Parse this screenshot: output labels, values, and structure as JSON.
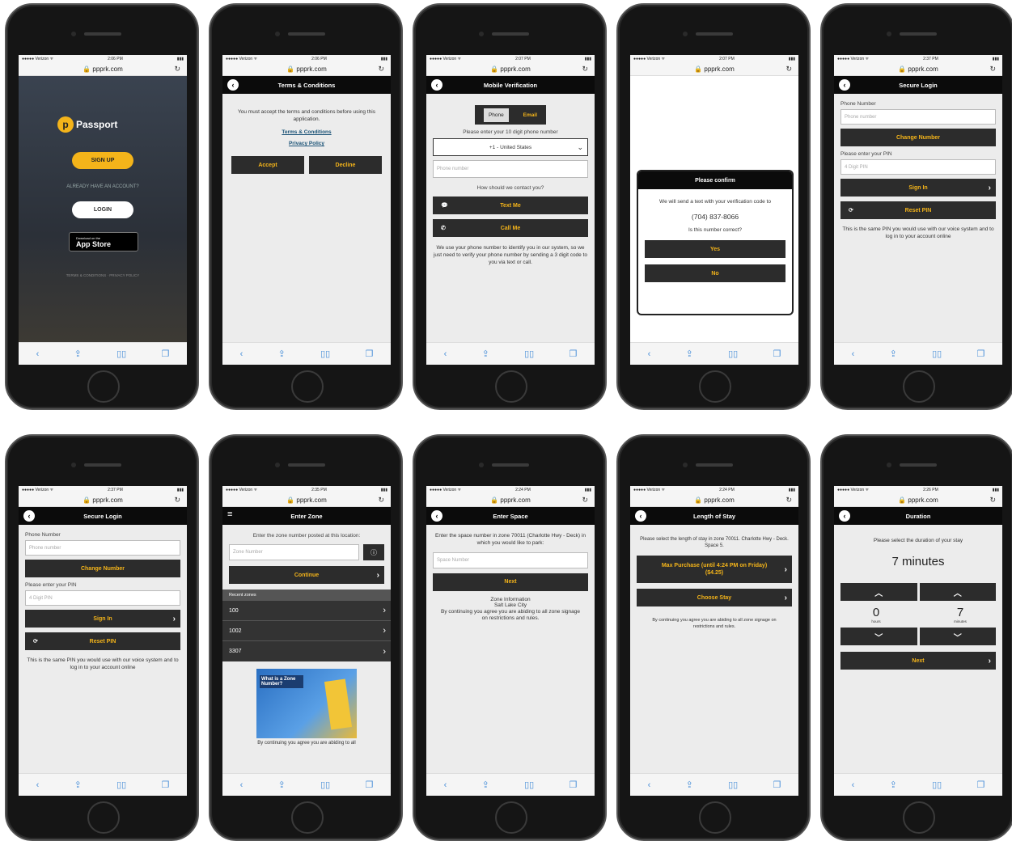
{
  "status": {
    "carrier": "●●●●● Verizon ᯤ",
    "battery": "▮▮▮"
  },
  "phones": [
    {
      "time": "2:06 PM",
      "url": "ppprk.com"
    },
    {
      "time": "2:06 PM",
      "url": "ppprk.com"
    },
    {
      "time": "2:07 PM",
      "url": "ppprk.com"
    },
    {
      "time": "2:07 PM",
      "url": "ppprk.com"
    },
    {
      "time": "2:37 PM",
      "url": "ppprk.com"
    },
    {
      "time": "2:37 PM",
      "url": "ppprk.com"
    },
    {
      "time": "2:35 PM",
      "url": "ppprk.com"
    },
    {
      "time": "2:24 PM",
      "url": "ppprk.com"
    },
    {
      "time": "2:24 PM",
      "url": "ppprk.com"
    },
    {
      "time": "2:26 PM",
      "url": "ppprk.com"
    }
  ],
  "splash": {
    "brand": "Passport",
    "signup": "SIGN UP",
    "already": "ALREADY HAVE AN ACCOUNT?",
    "login": "LOGIN",
    "store_small": "Download on the",
    "store": "App Store",
    "footer": "TERMS & CONDITIONS · PRIVACY POLICY"
  },
  "terms": {
    "title": "Terms & Conditions",
    "text": "You must accept the terms and conditions before using this application.",
    "link1": "Terms & Conditions",
    "link2": "Privacy Policy",
    "accept": "Accept",
    "decline": "Decline"
  },
  "mobile": {
    "title": "Mobile Verification",
    "tab_phone": "Phone",
    "tab_email": "Email",
    "prompt": "Please enter your 10 digit phone number",
    "country": "+1 - United States",
    "placeholder": "Phone number",
    "contact": "How should we contact you?",
    "text_me": "Text Me",
    "call_me": "Call Me",
    "info": "We use your phone number to identify you in our system, so we just need to verify your phone number by sending a 3 digit code to you via text or call."
  },
  "confirm": {
    "title": "Please confirm",
    "text": "We will send a text with your verification code to",
    "number": "(704) 837-8066",
    "question": "Is this number correct?",
    "yes": "Yes",
    "no": "No"
  },
  "login": {
    "title": "Secure Login",
    "phone_label": "Phone Number",
    "phone_placeholder": "Phone number",
    "change": "Change Number",
    "pin_label": "Please enter your PIN",
    "pin_placeholder": "4 Digit PIN",
    "signin": "Sign In",
    "reset": "Reset PIN",
    "info": "This is the same PIN you would use with our voice system and to log in to your account online"
  },
  "zone": {
    "title": "Enter Zone",
    "prompt": "Enter the zone number posted at this location:",
    "placeholder": "Zone Number",
    "continue": "Continue",
    "recent": "Recent zones",
    "zones": [
      "100",
      "1002",
      "3307"
    ],
    "promo_title": "What is a Zone Number?",
    "footer": "By continuing you agree you are abiding to all"
  },
  "space": {
    "title": "Enter Space",
    "prompt": "Enter the space number in zone 70011 (Charlotte Hwy - Deck) in which you would like to park:",
    "placeholder": "Space Number",
    "next": "Next",
    "info_title": "Zone Information",
    "info_city": "Salt Lake City",
    "info_text": "By continuing you agree you are abiding to all zone signage on restrictions and rules."
  },
  "stay": {
    "title": "Length of Stay",
    "prompt": "Please select the length of stay in zone 70011. Charlotte Hwy - Deck. Space 5.",
    "max": "Max Purchase (until 4:24 PM on Friday) ($4.25)",
    "choose": "Choose Stay",
    "info": "By continuing you agree you are abiding to all zone signage on restrictions and rules."
  },
  "duration": {
    "title": "Duration",
    "prompt": "Please select the duration of your stay",
    "value": "7 minutes",
    "hours": "0",
    "hours_label": "hours",
    "minutes": "7",
    "minutes_label": "minutes",
    "next": "Next"
  }
}
